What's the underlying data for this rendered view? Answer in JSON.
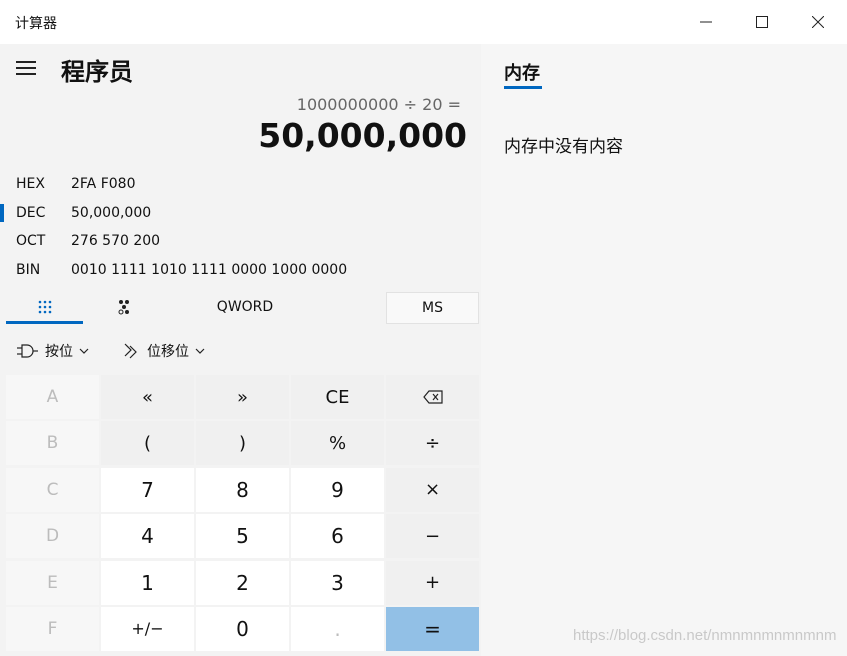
{
  "window": {
    "title": "计算器"
  },
  "header": {
    "mode_title": "程序员"
  },
  "display": {
    "expression": "1000000000 ÷ 20 =",
    "result": "50,000,000"
  },
  "radix": [
    {
      "label": "HEX",
      "value": "2FA F080",
      "selected": false
    },
    {
      "label": "DEC",
      "value": "50,000,000",
      "selected": true
    },
    {
      "label": "OCT",
      "value": "276 570 200",
      "selected": false
    },
    {
      "label": "BIN",
      "value": "0010 1111 1010 1111 0000 1000 0000",
      "selected": false
    }
  ],
  "tabs": {
    "word_size": "QWORD",
    "memory_store": "MS"
  },
  "operators": {
    "bitwise": "按位",
    "bit_shift": "位移位"
  },
  "keypad": [
    [
      "A",
      "«",
      "»",
      "CE",
      "⌫"
    ],
    [
      "B",
      "(",
      ")",
      "%",
      "÷"
    ],
    [
      "C",
      "7",
      "8",
      "9",
      "×"
    ],
    [
      "D",
      "4",
      "5",
      "6",
      "−"
    ],
    [
      "E",
      "1",
      "2",
      "3",
      "+"
    ],
    [
      "F",
      "+/−",
      "0",
      ".",
      "="
    ]
  ],
  "memory": {
    "tab_label": "内存",
    "empty_message": "内存中没有内容"
  },
  "watermark": "https://blog.csdn.net/nmnmnmnmnmnm",
  "colors": {
    "accent": "#0067c0",
    "equals_key": "#92c0e6"
  }
}
